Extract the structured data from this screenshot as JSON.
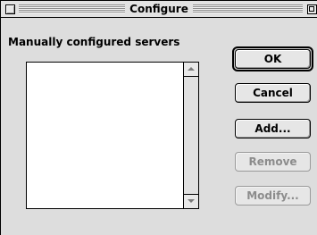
{
  "window": {
    "title": "Configure"
  },
  "list": {
    "label": "Manually configured servers",
    "items": []
  },
  "buttons": {
    "ok": "OK",
    "cancel": "Cancel",
    "add": "Add...",
    "remove": "Remove",
    "modify": "Modify..."
  }
}
